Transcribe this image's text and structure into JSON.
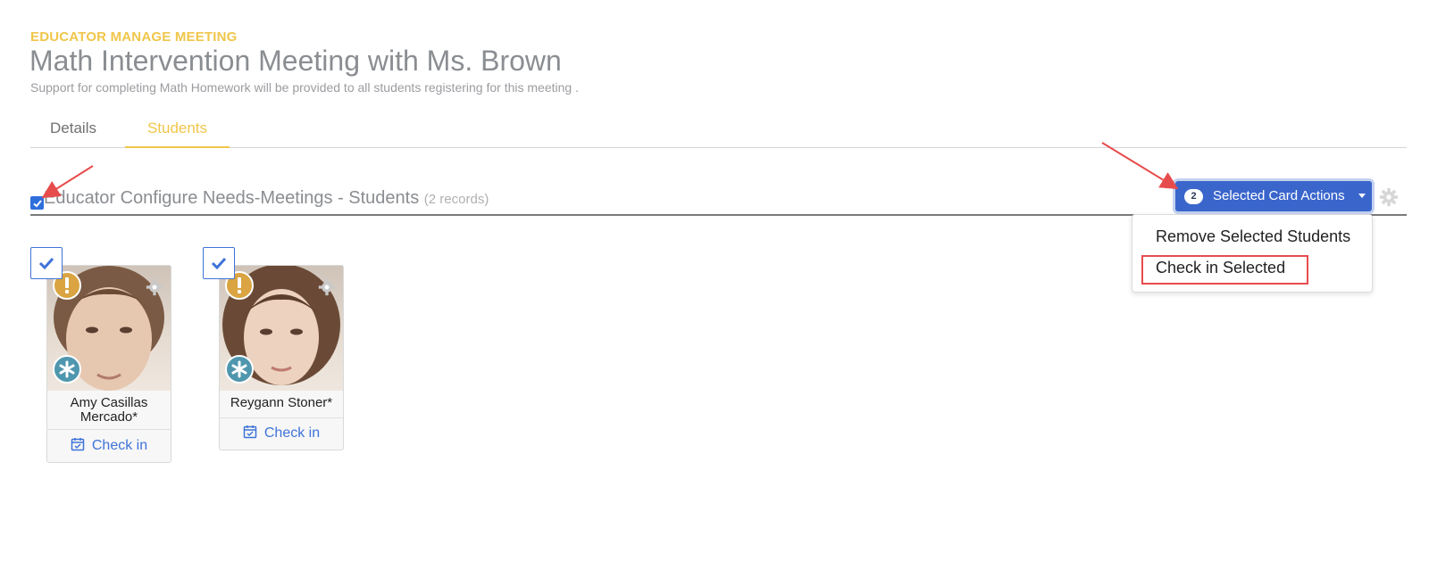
{
  "header": {
    "eyebrow": "EDUCATOR MANAGE MEETING",
    "title": "Math Intervention Meeting with Ms. Brown",
    "subtitle": "Support for completing Math Homework will be provided to all students registering for this meeting ."
  },
  "tabs": [
    {
      "label": "Details",
      "active": false
    },
    {
      "label": "Students",
      "active": true
    }
  ],
  "section": {
    "title": "Educator Configure Needs-Meetings - Students",
    "count": "(2 records)",
    "select_all_checked": true
  },
  "actions": {
    "badge": "2",
    "label": "Selected Card Actions",
    "menu": [
      {
        "label": "Remove Selected Students"
      },
      {
        "label": "Check in Selected"
      }
    ]
  },
  "cards": [
    {
      "name": "Amy Casillas Mercado*",
      "action": "Check in",
      "selected": true,
      "icons": [
        "alert-icon",
        "asterisk-icon",
        "gear-icon"
      ]
    },
    {
      "name": "Reygann Stoner*",
      "action": "Check in",
      "selected": true,
      "icons": [
        "alert-icon",
        "asterisk-icon",
        "gear-icon"
      ]
    }
  ],
  "colors": {
    "accent_yellow": "#f0c64a",
    "primary_blue": "#3a66cc",
    "link_blue": "#3f73d8",
    "alert_orange": "#d9a441",
    "asterisk_teal": "#4f97ae",
    "annotation_red": "#e74c4c"
  }
}
